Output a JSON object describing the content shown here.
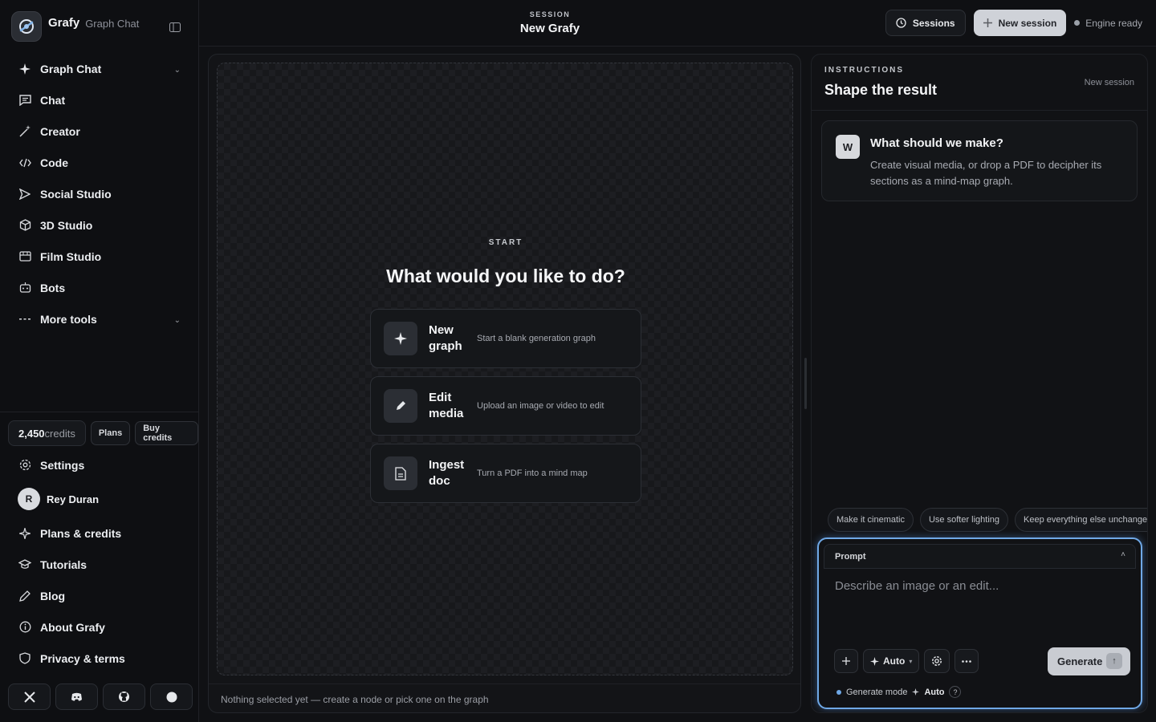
{
  "brand": {
    "name": "Grafy",
    "subtitle": "Graph Chat"
  },
  "nav": {
    "items": [
      {
        "label": "Graph Chat",
        "icon": "sparkle-icon"
      },
      {
        "label": "Chat",
        "icon": "message-icon"
      },
      {
        "label": "Creator",
        "icon": "wand-icon"
      },
      {
        "label": "Code",
        "icon": "code-icon"
      },
      {
        "label": "Social Studio",
        "icon": "send-icon"
      },
      {
        "label": "3D Studio",
        "icon": "cube-icon"
      },
      {
        "label": "Film Studio",
        "icon": "film-icon"
      },
      {
        "label": "Bots",
        "icon": "bot-icon"
      },
      {
        "label": "More tools",
        "icon": "ellipsis-icon"
      }
    ]
  },
  "credits": {
    "amount": "2,450",
    "unit": "credits",
    "plans_label": "Plans",
    "buy_label": "Buy credits"
  },
  "bottom_nav": {
    "settings": "Settings",
    "user": {
      "initial": "R",
      "name": "Rey Duran"
    },
    "plans_credits": "Plans & credits",
    "tutorials": "Tutorials",
    "blog": "Blog",
    "about": "About Grafy",
    "privacy": "Privacy & terms"
  },
  "header": {
    "session_label": "SESSION",
    "session_title": "New Grafy",
    "sessions_btn": "Sessions",
    "new_session_btn": "New session",
    "engine_status": "Engine ready"
  },
  "canvas": {
    "start_label": "START",
    "start_title": "What would you like to do?",
    "options": [
      {
        "title": "New graph",
        "desc": "Start a blank generation graph"
      },
      {
        "title": "Edit media",
        "desc": "Upload an image or video to edit"
      },
      {
        "title": "Ingest doc",
        "desc": "Turn a PDF into a mind map"
      }
    ],
    "status": "Nothing selected yet — create a node or pick one on the graph"
  },
  "instructions": {
    "label": "INSTRUCTIONS",
    "title": "Shape the result",
    "session_tag": "New session",
    "message": {
      "avatar": "W",
      "title": "What should we make?",
      "body": "Create visual media, or drop a PDF to decipher its sections as a mind-map graph."
    },
    "chips": [
      "Make it cinematic",
      "Use softer lighting",
      "Keep everything else unchanged"
    ]
  },
  "prompt": {
    "label": "Prompt",
    "placeholder": "Describe an image or an edit...",
    "mode_btn": "Auto",
    "generate_label": "Generate",
    "mode_caption": "Generate mode",
    "mode_value": "Auto",
    "help": "?"
  },
  "colors": {
    "accent": "#6fa8e6",
    "primary_btn": "#cfd2d8",
    "bg": "#101114"
  }
}
